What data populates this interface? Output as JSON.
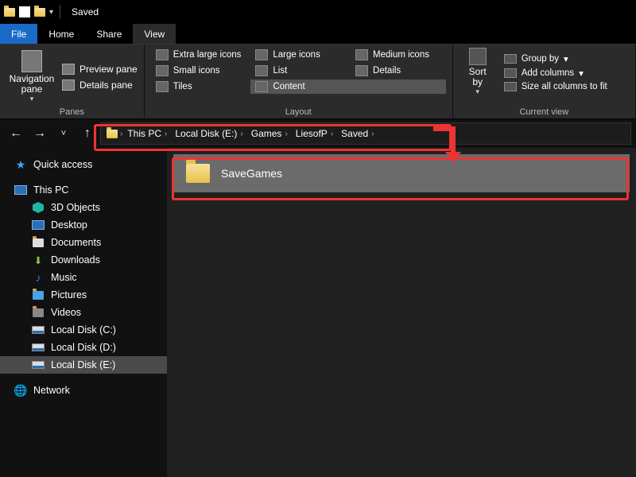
{
  "window": {
    "title": "Saved"
  },
  "menu": {
    "file": "File",
    "home": "Home",
    "share": "Share",
    "view": "View"
  },
  "ribbon": {
    "panes": {
      "navigation": "Navigation\npane",
      "preview": "Preview pane",
      "details": "Details pane",
      "group": "Panes"
    },
    "layout": {
      "extra_large": "Extra large icons",
      "large": "Large icons",
      "medium": "Medium icons",
      "small": "Small icons",
      "list": "List",
      "details": "Details",
      "tiles": "Tiles",
      "content": "Content",
      "group": "Layout"
    },
    "currentview": {
      "sort": "Sort\nby",
      "groupby": "Group by",
      "addcols": "Add columns",
      "sizeall": "Size all columns to fit",
      "group": "Current view"
    }
  },
  "breadcrumb": {
    "items": [
      "This PC",
      "Local Disk (E:)",
      "Games",
      "LiesofP",
      "Saved"
    ]
  },
  "sidebar": {
    "quick": "Quick access",
    "thispc": "This PC",
    "children": [
      "3D Objects",
      "Desktop",
      "Documents",
      "Downloads",
      "Music",
      "Pictures",
      "Videos",
      "Local Disk (C:)",
      "Local Disk (D:)",
      "Local Disk (E:)"
    ],
    "network": "Network"
  },
  "content": {
    "folder": "SaveGames"
  }
}
